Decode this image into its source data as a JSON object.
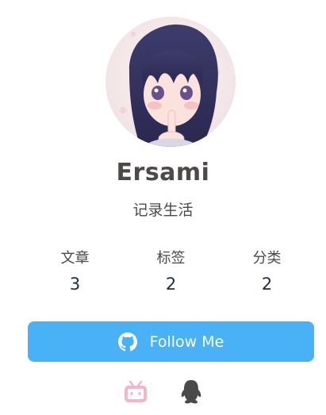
{
  "profile": {
    "name": "Ersami",
    "bio": "记录生活"
  },
  "stats": [
    {
      "label": "文章",
      "count": "3"
    },
    {
      "label": "标签",
      "count": "2"
    },
    {
      "label": "分类",
      "count": "2"
    }
  ],
  "follow": {
    "label": "Follow Me",
    "icon": "github-icon"
  },
  "socials": [
    {
      "icon": "bilibili-icon",
      "color": "#f4b6c6"
    },
    {
      "icon": "qq-icon",
      "color": "#4a4a4a"
    }
  ],
  "colors": {
    "accent": "#49b1f5",
    "text": "#4c4948",
    "count": "#1f2d3d"
  }
}
